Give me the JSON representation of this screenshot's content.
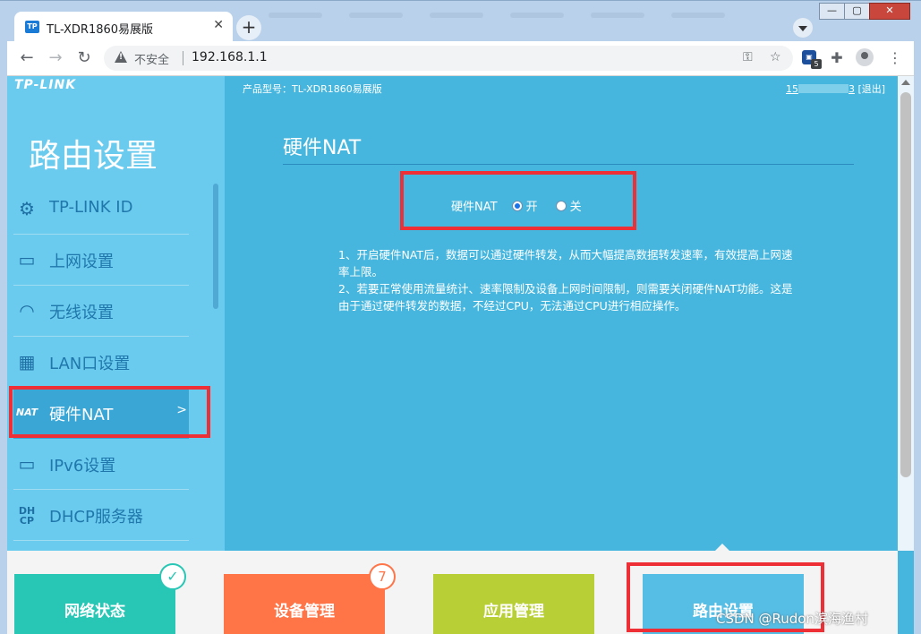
{
  "browser": {
    "tab_title": "TL-XDR1860易展版",
    "tab_favicon": "TP",
    "new_tab": "+",
    "close_tab": "✕",
    "window_buttons": [
      "—",
      "▢",
      "✕"
    ],
    "nav": {
      "back": "←",
      "forward": "→",
      "reload": "↻"
    },
    "address": {
      "insecure_label": "不安全",
      "url": "192.168.1.1"
    },
    "icons": {
      "key": "key-icon",
      "star": "star-icon",
      "puzzle": "puzzle-icon",
      "menu": "more-vert-icon"
    },
    "extension_badge": "5"
  },
  "header": {
    "brand": "TP-LINK",
    "model": "产品型号：TL-XDR1860易展版",
    "user_prefix": "15",
    "user_suffix": "3",
    "logout": "[退出]"
  },
  "sidebar": {
    "title": "路由设置",
    "items": [
      {
        "label": "TP-LINK ID",
        "icon": "gear-icon",
        "glyph": "⚙"
      },
      {
        "label": "上网设置",
        "icon": "laptop-icon",
        "glyph": "▭"
      },
      {
        "label": "无线设置",
        "icon": "wifi-icon",
        "glyph": "◠"
      },
      {
        "label": "LAN口设置",
        "icon": "ethernet-icon",
        "glyph": "▦"
      },
      {
        "label": "硬件NAT",
        "icon": "nat-icon",
        "glyph": "NAT",
        "arrow": ">"
      },
      {
        "label": "IPv6设置",
        "icon": "laptop-icon",
        "glyph": "▭"
      },
      {
        "label": "DHCP服务器",
        "icon": "dhcp-icon",
        "glyph": "DH\nCP"
      }
    ]
  },
  "main": {
    "title": "硬件NAT",
    "nat": {
      "label": "硬件NAT",
      "option_on": "开",
      "option_off": "关",
      "selected": "开"
    },
    "notes": [
      "1、开启硬件NAT后，数据可以通过硬件转发，从而大幅提高数据转发速率，有效提高上网速率上限。",
      "2、若要正常使用流量统计、速率限制及设备上网时间限制，则需要关闭硬件NAT功能。这是由于通过硬件转发的数据，不经过CPU，无法通过CPU进行相应操作。"
    ]
  },
  "footer": {
    "tabs": [
      {
        "label": "网络状态",
        "color": "#28c7b5"
      },
      {
        "label": "设备管理",
        "color": "#ff7548",
        "badge": "7"
      },
      {
        "label": "应用管理",
        "color": "#b8cf36"
      },
      {
        "label": "路由设置",
        "color": "#56bde4"
      }
    ],
    "check_glyph": "✓"
  },
  "watermark": "CSDN @Rudon滨海渔村",
  "highlight_color": "#ee2f36"
}
